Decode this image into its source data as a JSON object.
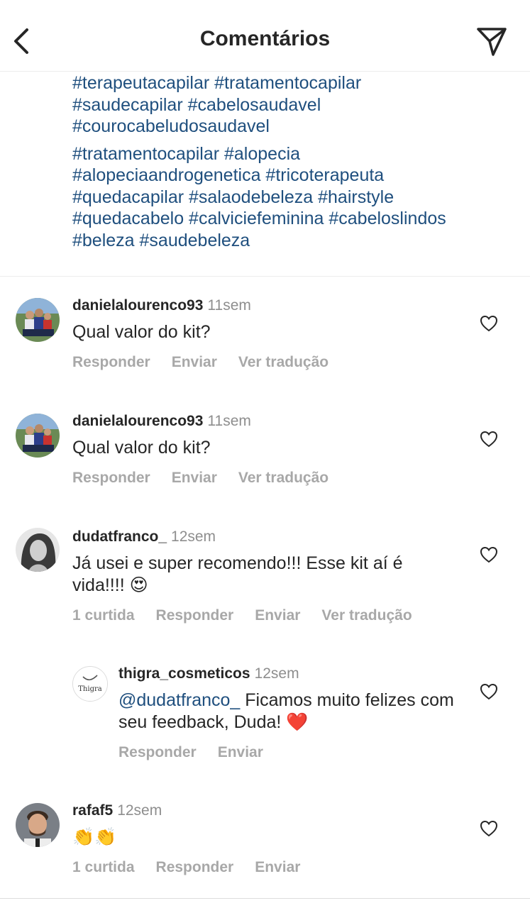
{
  "header": {
    "title": "Comentários"
  },
  "caption": {
    "block1": "#terapeutacapilar #tratamentocapilar\n#saudecapilar #cabelosaudavel\n#courocabeludosaudavel",
    "block2": "#tratamentocapilar #alopecia\n#alopeciaandrogenetica #tricoterapeuta\n#quedacapilar #salaodebeleza #hairstyle\n#quedacabelo  #calviciefeminina #cabeloslindos\n#beleza #saudebeleza"
  },
  "comments": [
    {
      "username": "danielalourenco93",
      "time": "11sem",
      "text": "Qual valor do kit?",
      "reply": "Responder",
      "send": "Enviar",
      "translate": "Ver tradução"
    },
    {
      "username": "danielalourenco93",
      "time": "11sem",
      "text": "Qual valor do kit?",
      "reply": "Responder",
      "send": "Enviar",
      "translate": "Ver tradução"
    },
    {
      "username": "dudatfranco_",
      "time": "12sem",
      "text": "Já usei e super recomendo!!! Esse kit aí é vida!!!! 😍",
      "likes": "1 curtida",
      "reply": "Responder",
      "send": "Enviar",
      "translate": "Ver tradução"
    },
    {
      "username": "thigra_cosmeticos",
      "time": "12sem",
      "mention": "@dudatfranco_",
      "text": "Ficamos muito felizes com seu feedback, Duda! ❤️",
      "avatar_text": "Thigra",
      "reply": "Responder",
      "send": "Enviar"
    },
    {
      "username": "rafaf5",
      "time": "12sem",
      "text": "👏👏",
      "likes": "1 curtida",
      "reply": "Responder",
      "send": "Enviar"
    }
  ],
  "icons": {
    "back": "chevron-left-icon",
    "send": "paper-plane-icon",
    "like": "heart-outline-icon"
  },
  "colors": {
    "hashtag": "#1f4f7e",
    "muted": "#8e8e8e",
    "action": "#a8a8a8",
    "heart": "#e0181f"
  }
}
